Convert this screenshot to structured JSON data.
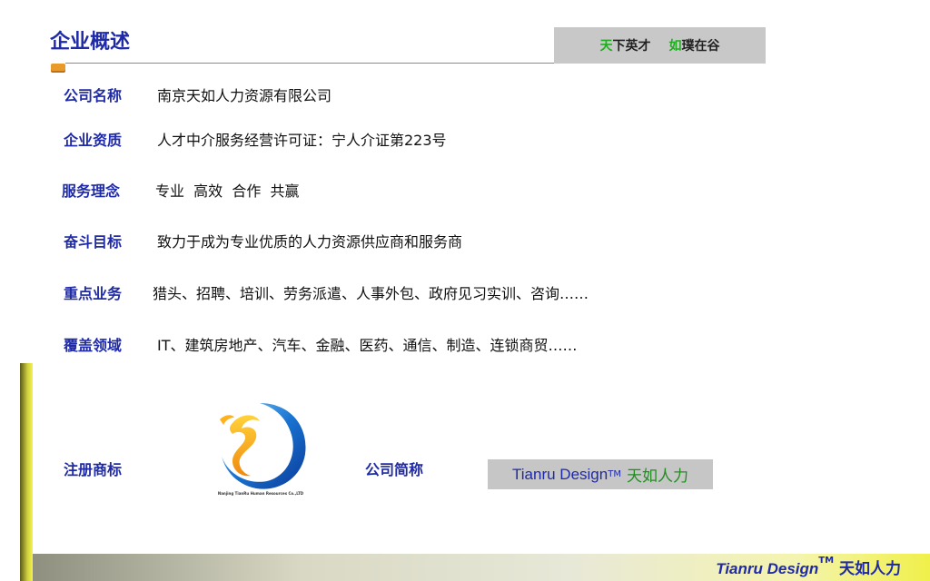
{
  "header": {
    "title": "企业概述",
    "motto_part1_highlight": "天",
    "motto_part1_rest": "下英才",
    "motto_part2_highlight": "如",
    "motto_part2_rest": "璞在谷"
  },
  "rows": [
    {
      "label": "公司名称",
      "value": "南京天如人力资源有限公司"
    },
    {
      "label": "企业资质",
      "value": "人才中介服务经营许可证：宁人介证第223号"
    },
    {
      "label": "服务理念",
      "value": "专业  高效  合作  共赢"
    },
    {
      "label": "奋斗目标",
      "value": "致力于成为专业优质的人力资源供应商和服务商"
    },
    {
      "label": "重点业务",
      "value": "猎头、招聘、培训、劳务派遣、人事外包、政府见习实训、咨询……"
    },
    {
      "label": "覆盖领域",
      "value": "IT、建筑房地产、汽车、金融、医药、通信、制造、连锁商贸……"
    }
  ],
  "trademark_label": "注册商标",
  "logo": {
    "caption": "Nanjing TianRu Human Resources Co.,LTD",
    "icon": "dragon-logo-icon"
  },
  "short_name_label": "公司简称",
  "short_name": {
    "en": "Tianru Design",
    "tm": "TM",
    "cn": "天如人力"
  },
  "footer": {
    "en": "Tianru Design",
    "tm": "TM",
    "cn": "天如人力"
  },
  "colors": {
    "label": "#1f2aa6",
    "accent_green": "#1fae1f",
    "accent_orange": "#e89a2a"
  }
}
